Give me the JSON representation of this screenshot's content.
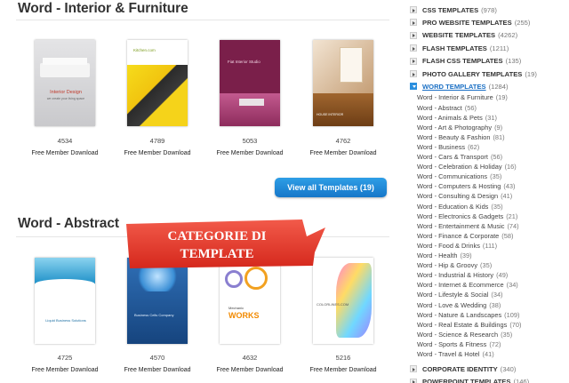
{
  "sections": [
    {
      "title": "Word - Interior & Furniture",
      "items": [
        {
          "id": "4534",
          "download": "Free Member Download",
          "thumb_text": "Interior Design",
          "thumb_subtext": "we create your living space"
        },
        {
          "id": "4789",
          "download": "Free Member Download",
          "thumb_text": "Kitchen.com",
          "thumb_subtext": ""
        },
        {
          "id": "5053",
          "download": "Free Member Download",
          "thumb_text": "Fiat Interior Studio",
          "thumb_subtext": ""
        },
        {
          "id": "4762",
          "download": "Free Member Download",
          "thumb_text": "HOUSE INTERIOR",
          "thumb_subtext": ""
        }
      ],
      "view_all": "View all Templates (19)"
    },
    {
      "title": "Word - Abstract",
      "items": [
        {
          "id": "4725",
          "download": "Free Member Download",
          "thumb_text": "Liquid Business Solutions",
          "thumb_subtext": ""
        },
        {
          "id": "4570",
          "download": "Free Member Download",
          "thumb_text": "Business Cells Company",
          "thumb_subtext": ""
        },
        {
          "id": "4632",
          "download": "Free Member Download",
          "thumb_text": "WORKS",
          "thumb_subtext": "Mechanic"
        },
        {
          "id": "5216",
          "download": "Free Member Download",
          "thumb_text": "COLORLINES.COM",
          "thumb_subtext": ""
        }
      ]
    }
  ],
  "banner": {
    "line1": "CATEGORIE DI",
    "line2": "TEMPLATE",
    "color": "#e53a2c"
  },
  "sidebar": {
    "categories_top": [
      {
        "name": "CSS TEMPLATES",
        "count": "(978)"
      },
      {
        "name": "PRO WEBSITE TEMPLATES",
        "count": "(255)"
      },
      {
        "name": "WEBSITE TEMPLATES",
        "count": "(4262)"
      },
      {
        "name": "FLASH TEMPLATES",
        "count": "(1211)"
      },
      {
        "name": "FLASH CSS TEMPLATES",
        "count": "(135)"
      },
      {
        "name": "PHOTO GALLERY TEMPLATES",
        "count": "(19)"
      }
    ],
    "active_category": {
      "name": "WORD TEMPLATES",
      "count": "(1284)"
    },
    "subcategories": [
      {
        "name": "Word - Interior & Furniture",
        "count": "(19)"
      },
      {
        "name": "Word - Abstract",
        "count": "(56)"
      },
      {
        "name": "Word - Animals & Pets",
        "count": "(31)"
      },
      {
        "name": "Word - Art & Photography",
        "count": "(9)"
      },
      {
        "name": "Word - Beauty & Fashion",
        "count": "(81)"
      },
      {
        "name": "Word - Business",
        "count": "(62)"
      },
      {
        "name": "Word - Cars & Transport",
        "count": "(56)"
      },
      {
        "name": "Word - Celebration & Holiday",
        "count": "(16)"
      },
      {
        "name": "Word - Communications",
        "count": "(35)"
      },
      {
        "name": "Word - Computers & Hosting",
        "count": "(43)"
      },
      {
        "name": "Word - Consulting & Design",
        "count": "(41)"
      },
      {
        "name": "Word - Education & Kids",
        "count": "(35)"
      },
      {
        "name": "Word - Electronics & Gadgets",
        "count": "(21)"
      },
      {
        "name": "Word - Entertainment & Music",
        "count": "(74)"
      },
      {
        "name": "Word - Finance & Corporate",
        "count": "(58)"
      },
      {
        "name": "Word - Food & Drinks",
        "count": "(111)"
      },
      {
        "name": "Word - Health",
        "count": "(39)"
      },
      {
        "name": "Word - Hip & Groovy",
        "count": "(35)"
      },
      {
        "name": "Word - Industrial & History",
        "count": "(49)"
      },
      {
        "name": "Word - Internet & Ecommerce",
        "count": "(34)"
      },
      {
        "name": "Word - Lifestyle & Social",
        "count": "(34)"
      },
      {
        "name": "Word - Love & Wedding",
        "count": "(38)"
      },
      {
        "name": "Word - Nature & Landscapes",
        "count": "(109)"
      },
      {
        "name": "Word - Real Estate & Buildings",
        "count": "(70)"
      },
      {
        "name": "Word - Science & Research",
        "count": "(35)"
      },
      {
        "name": "Word - Sports & Fitness",
        "count": "(72)"
      },
      {
        "name": "Word - Travel & Hotel",
        "count": "(41)"
      }
    ],
    "categories_bottom": [
      {
        "name": "CORPORATE IDENTITY",
        "count": "(340)"
      },
      {
        "name": "POWERPOINT TEMPLATES",
        "count": "(146)"
      }
    ]
  }
}
